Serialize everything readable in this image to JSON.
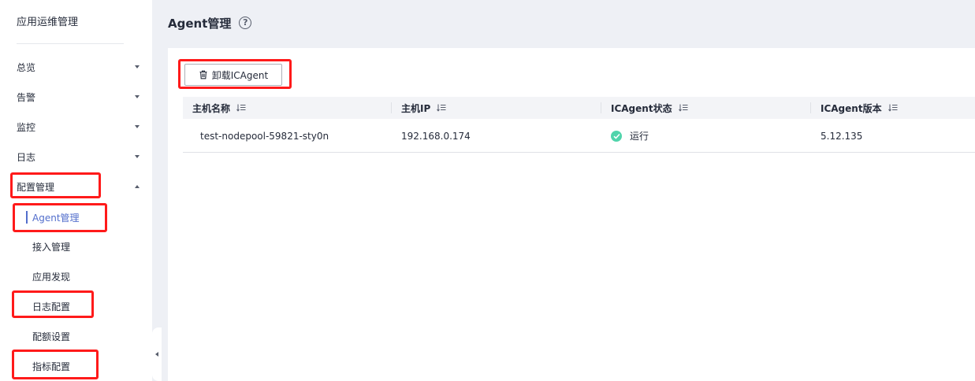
{
  "sidebar": {
    "title": "应用运维管理",
    "groups": [
      {
        "label": "总览",
        "expanded": false
      },
      {
        "label": "告警",
        "expanded": false
      },
      {
        "label": "监控",
        "expanded": false
      },
      {
        "label": "日志",
        "expanded": false
      },
      {
        "label": "配置管理",
        "expanded": true
      }
    ],
    "config_items": [
      {
        "label": "Agent管理",
        "active": true
      },
      {
        "label": "接入管理",
        "active": false
      },
      {
        "label": "应用发现",
        "active": false
      },
      {
        "label": "日志配置",
        "active": false
      },
      {
        "label": "配额设置",
        "active": false
      },
      {
        "label": "指标配置",
        "active": false
      }
    ]
  },
  "header": {
    "title": "Agent管理",
    "help_icon": "question-circle-icon"
  },
  "toolbar": {
    "uninstall_label": "卸载ICAgent",
    "uninstall_icon": "trash-icon"
  },
  "table": {
    "columns": [
      "主机名称",
      "主机IP",
      "ICAgent状态",
      "ICAgent版本"
    ],
    "rows": [
      {
        "host_name": "test-nodepool-59821-sty0n",
        "host_ip": "192.168.0.174",
        "status": "运行",
        "version": "5.12.135"
      }
    ]
  },
  "colors": {
    "accent": "#526ecc",
    "status_running": "#50d4ab",
    "highlight": "#ff1a1a"
  }
}
